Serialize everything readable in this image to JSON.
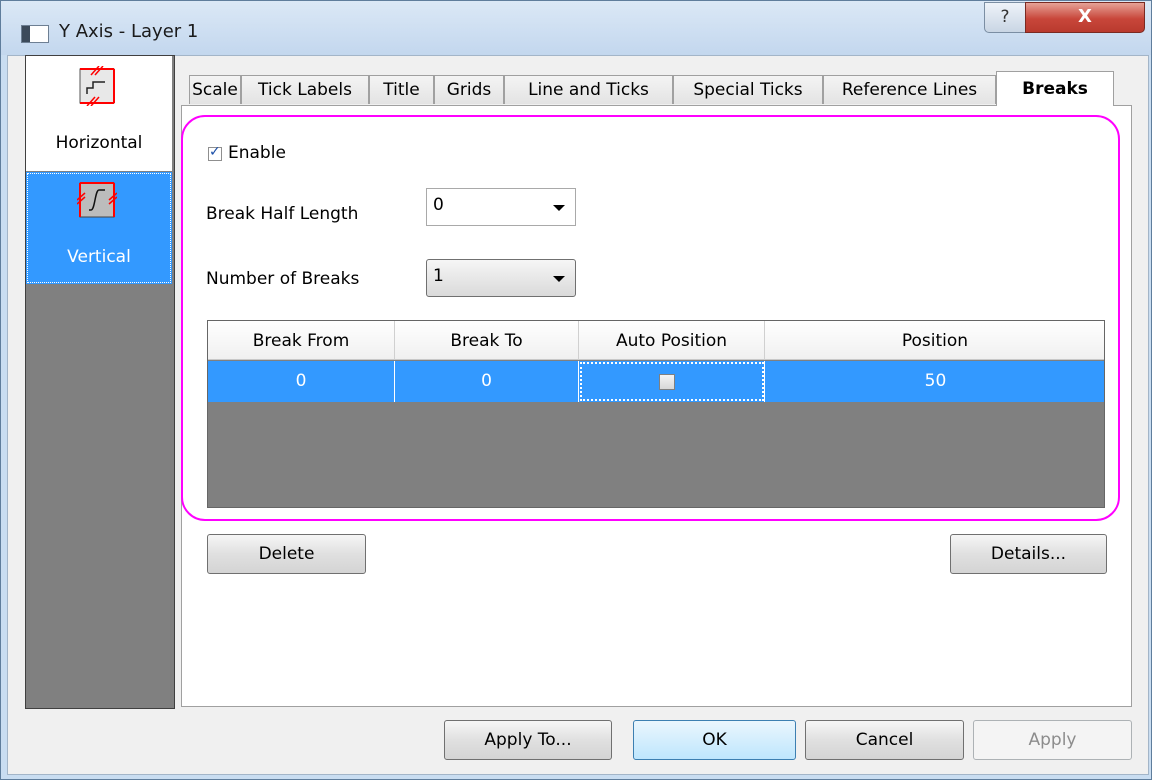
{
  "window": {
    "title": "Y Axis - Layer 1",
    "help_label": "?",
    "close_label": "X"
  },
  "sidebar": {
    "items": [
      {
        "label": "Horizontal",
        "icon": "horizontal-break-icon",
        "selected": false
      },
      {
        "label": "Vertical",
        "icon": "vertical-break-icon",
        "selected": true
      }
    ]
  },
  "tabs": [
    {
      "label": "Scale"
    },
    {
      "label": "Tick Labels"
    },
    {
      "label": "Title"
    },
    {
      "label": "Grids"
    },
    {
      "label": "Line and Ticks"
    },
    {
      "label": "Special Ticks"
    },
    {
      "label": "Reference Lines"
    },
    {
      "label": "Breaks",
      "active": true
    }
  ],
  "breaks": {
    "enable_label": "Enable",
    "enable_checked": true,
    "half_length_label": "Break Half Length",
    "half_length_value": "0",
    "num_breaks_label": "Number of Breaks",
    "num_breaks_value": "1"
  },
  "table": {
    "columns": [
      "Break From",
      "Break To",
      "Auto Position",
      "Position"
    ],
    "rows": [
      {
        "break_from": "0",
        "break_to": "0",
        "auto_position": false,
        "position": "50"
      }
    ]
  },
  "buttons": {
    "delete": "Delete",
    "details": "Details...",
    "apply_to": "Apply To...",
    "ok": "OK",
    "cancel": "Cancel",
    "apply": "Apply"
  },
  "colors": {
    "selection": "#3399ff",
    "highlight_outline": "#ff00ff",
    "break_icon_red": "#ff0000"
  }
}
